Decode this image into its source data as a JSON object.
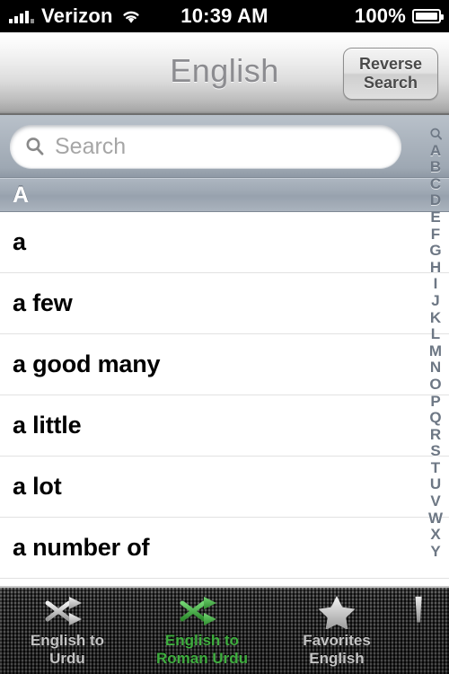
{
  "status_bar": {
    "carrier": "Verizon",
    "signal_icon": "signal-bars-icon",
    "wifi_icon": "wifi-icon",
    "time": "10:39 AM",
    "battery_percent": "100%",
    "battery_icon": "battery-full-icon"
  },
  "nav_bar": {
    "title": "English",
    "reverse_search": {
      "line1": "Reverse",
      "line2": "Search"
    }
  },
  "search": {
    "icon": "search-icon",
    "placeholder": "Search",
    "value": ""
  },
  "section": {
    "header": "A"
  },
  "list": {
    "items": [
      {
        "label": "a"
      },
      {
        "label": "a few"
      },
      {
        "label": "a good many"
      },
      {
        "label": "a little"
      },
      {
        "label": "a lot"
      },
      {
        "label": "a number of"
      }
    ]
  },
  "index_strip": {
    "search_icon": "search-icon",
    "letters": [
      "A",
      "B",
      "C",
      "D",
      "E",
      "F",
      "G",
      "H",
      "I",
      "J",
      "K",
      "L",
      "M",
      "N",
      "O",
      "P",
      "Q",
      "R",
      "S",
      "T",
      "U",
      "V",
      "W",
      "X",
      "Y"
    ]
  },
  "tab_bar": {
    "tabs": [
      {
        "icon": "shuffle-icon",
        "line1": "English to",
        "line2": "Urdu",
        "selected": false
      },
      {
        "icon": "shuffle-icon",
        "line1": "English to",
        "line2": "Roman Urdu",
        "selected": true
      },
      {
        "icon": "star-icon",
        "line1": "Favorites",
        "line2": "English",
        "selected": false
      }
    ],
    "partial_tab_icon": "partial-tab-icon"
  },
  "colors": {
    "accent_green": "#3fae3f",
    "nav_title_gray": "#8c8c90",
    "search_bg": "#a9b2bc",
    "section_header_bg": "#9ba5b1",
    "tab_inactive": "#c4c4c4"
  }
}
